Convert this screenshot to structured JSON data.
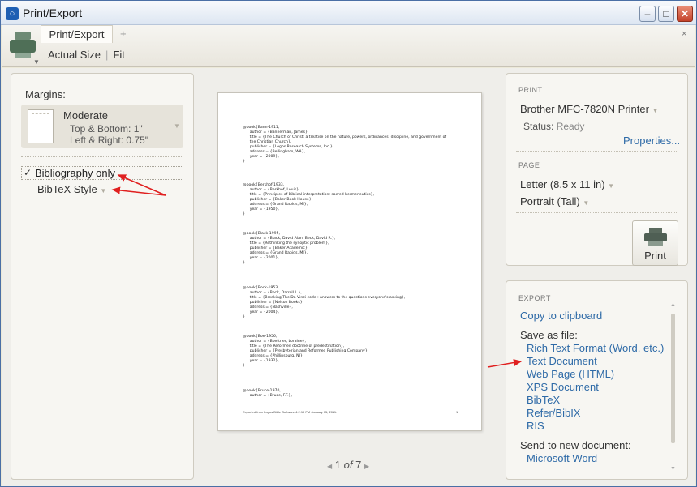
{
  "window": {
    "title": "Print/Export",
    "minimize": "–",
    "maximize": "□",
    "close": "✕"
  },
  "toolbar": {
    "tab_label": "Print/Export",
    "tab_add": "+",
    "tab_close": "×",
    "actual_size": "Actual Size",
    "fit": "Fit",
    "icon": "printer-icon"
  },
  "left": {
    "margins_label": "Margins:",
    "margin_name": "Moderate",
    "top_bottom": "Top & Bottom: 1\"",
    "left_right": "Left & Right:   0.75\"",
    "bibliography_check": "✓",
    "bibliography_label": "Bibliography only",
    "bibtex_style": "BibTeX Style"
  },
  "preview": {
    "entries": [
      "@book{Bann-1911,\n      author = {Bannerman, James},\n      title = {The Church of Christ: a treatise on the nature, powers, ordinances, discipline, and government of\n      the Christian Church},\n      publisher = {Logos Research Systems, Inc.},\n      address = {Bellingham, WA},\n      year = {2009},\n}",
      "@book{Berkhof-1933,\n      author = {Berkhof, Louis},\n      title = {Principles of Biblical interpretation: sacred hermeneutics},\n      publisher = {Baker Book House},\n      address = {Grand Rapids, MI},\n      year = {1950},\n}",
      "@book{Black-1995,\n      author = {Black, David Alan, Beck, David R.},\n      title = {Rethinking the synoptic problem},\n      publisher = {Baker Academic},\n      address = {Grand Rapids, MI},\n      year = {2001},\n}",
      "@book{Bock-1953,\n      author = {Bock, Darrell L.},\n      title = {Breaking The Da Vinci code : answers to the questions everyone's asking},\n      publisher = {Nelson Books},\n      address = {Nashville},\n      year = {2004},\n}",
      "@book{Boe-1956,\n      author = {Boettner, Loraine},\n      title = {The Reformed doctrine of predestination},\n      publisher = {Presbyterian and Reformed Publishing Company},\n      address = {Phillipsburg, NJ},\n      year = {1932},\n}",
      "@book{Bruce-1970,\n      author = {Bruce, F.F.},"
    ],
    "footer": "Exported from Logos Bible Software 4.2.19 PM January 05, 2011.",
    "page_number": "1"
  },
  "pager": {
    "current": "1",
    "of_label": "of",
    "total": "7"
  },
  "print": {
    "heading": "PRINT",
    "printer": "Brother MFC-7820N Printer",
    "status_label": "Status:",
    "status_value": "Ready",
    "properties": "Properties...",
    "page_heading": "PAGE",
    "paper": "Letter (8.5 x 11 in)",
    "orientation": "Portrait (Tall)",
    "print_button": "Print"
  },
  "export": {
    "heading": "EXPORT",
    "copy": "Copy to clipboard",
    "save_as": "Save as file:",
    "formats": [
      "Rich Text Format (Word, etc.)",
      "Text Document",
      "Web Page (HTML)",
      "XPS Document",
      "BibTeX",
      "Refer/BibIX",
      "RIS"
    ],
    "send_to": "Send to new document:",
    "word": "Microsoft Word"
  },
  "colors": {
    "link": "#2e6aa7",
    "annotation_arrow": "#e02020"
  }
}
